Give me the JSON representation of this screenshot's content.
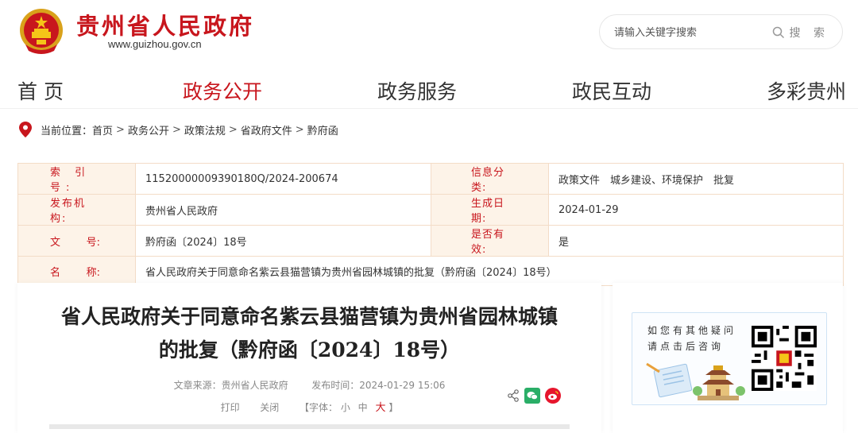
{
  "header": {
    "site_title": "贵州省人民政府",
    "site_url": "www.guizhou.gov.cn",
    "search_placeholder": "请输入关键字搜索",
    "search_label": "搜 索"
  },
  "nav": {
    "items": [
      "首 页",
      "政务公开",
      "政务服务",
      "政民互动",
      "多彩贵州"
    ],
    "active_index": 1
  },
  "breadcrumb": {
    "prefix": "当前位置：",
    "items": [
      "首页",
      "政务公开",
      "政策法规",
      "省政府文件",
      "黔府函"
    ],
    "separator": ">"
  },
  "info": {
    "index_label": "索 引 号:",
    "index_value": "11520000009390180Q/2024-200674",
    "category_label": "信息分类:",
    "category_value": "政策文件　城乡建设、环境保护　批复",
    "publisher_label": "发布机构:",
    "publisher_value": "贵州省人民政府",
    "date_label": "生成日期:",
    "date_value": "2024-01-29",
    "docno_label_a": "文",
    "docno_label_b": "号:",
    "docno_value": "黔府函〔2024〕18号",
    "valid_label": "是否有效:",
    "valid_value": "是",
    "name_label_a": "名",
    "name_label_b": "称:",
    "name_value": "省人民政府关于同意命名紫云县猫营镇为贵州省园林城镇的批复（黔府函〔2024〕18号）"
  },
  "article": {
    "title_line1": "省人民政府关于同意命名紫云县猫营镇为贵州省园林城镇",
    "title_line2": "的批复（黔府函〔2024〕18号）",
    "source": "文章来源：贵州省人民政府",
    "publish_time": "发布时间：2024-01-29 15:06",
    "print": "打印",
    "close": "关闭",
    "font_prefix": "【字体：",
    "font_small": "小",
    "font_medium": "中",
    "font_large": "大",
    "font_suffix": "】"
  },
  "side": {
    "qa_line1": "如您有其他疑问",
    "qa_line2": "请点击后咨询"
  },
  "colors": {
    "brand_red": "#c8161d",
    "label_bg": "#fdf3e8",
    "table_border": "#f3dcc7",
    "wechat_green": "#2aae67",
    "weibo_red": "#e6162d"
  },
  "icons": [
    "national-emblem-icon",
    "search-icon",
    "location-pin-icon",
    "share-icon",
    "wechat-icon",
    "weibo-icon",
    "qr-code-icon"
  ]
}
